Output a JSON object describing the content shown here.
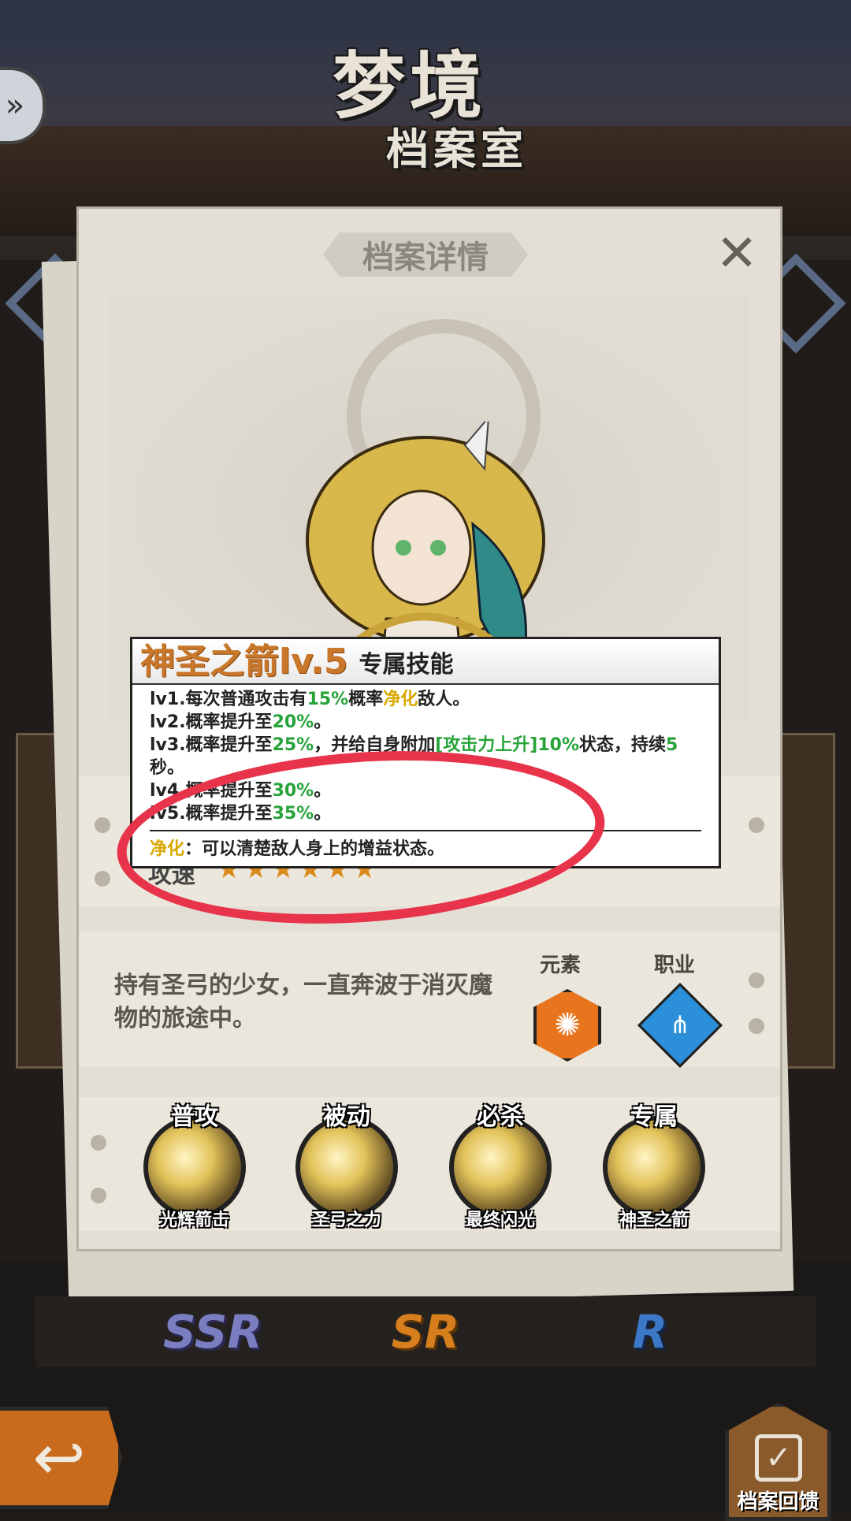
{
  "title": {
    "line1": "梦境",
    "line2": "档案室"
  },
  "card": {
    "header": "档案详情",
    "close_icon": "✕"
  },
  "skill_popup": {
    "name": "神圣之箭lv.5",
    "tag": "专属技能",
    "lines": {
      "lv1_pre": "lv1.每次普通攻击有",
      "lv1_pct": "15%",
      "lv1_mid": "概率",
      "lv1_key": "净化",
      "lv1_post": "敌人。",
      "lv2_pre": "lv2.概率提升至",
      "lv2_pct": "20%",
      "lv2_post": "。",
      "lv3_pre": "lv3.概率提升至",
      "lv3_pct": "25%",
      "lv3_mid": "，并给自身附加",
      "lv3_buff": "[攻击力上升]10%",
      "lv3_mid2": "状态，持续",
      "lv3_sec": "5",
      "lv3_post": "秒。",
      "lv4_pre": "lv4.概率提升至",
      "lv4_pct": "30%",
      "lv4_post": "。",
      "lv5_pre": "lv5.概率提升至",
      "lv5_pct": "35%",
      "lv5_post": "。"
    },
    "note_key": "净化",
    "note_text": "：可以清楚敌人身上的增益状态。"
  },
  "stats": {
    "attack_label": "攻速",
    "stars": "★★★★★★"
  },
  "description": {
    "text": "持有圣弓的少女，一直奔波于消灭魔物的旅途中。",
    "element_label": "元素",
    "class_label": "职业",
    "element_icon": "fire-element-icon",
    "class_icon": "trident-class-icon"
  },
  "skills": [
    {
      "type": "普攻",
      "name": "光辉箭击"
    },
    {
      "type": "被动",
      "name": "圣弓之力"
    },
    {
      "type": "必杀",
      "name": "最终闪光"
    },
    {
      "type": "专属",
      "name": "神圣之箭"
    }
  ],
  "rarity_tabs": {
    "ssr": "SSR",
    "sr": "SR",
    "r": "R"
  },
  "feedback_button": {
    "label": "档案回馈"
  },
  "colors": {
    "highlight_green": "#27a33a",
    "highlight_yellow": "#d9a800",
    "skill_name": "#c9772a",
    "annotation_red": "#e8344a"
  }
}
